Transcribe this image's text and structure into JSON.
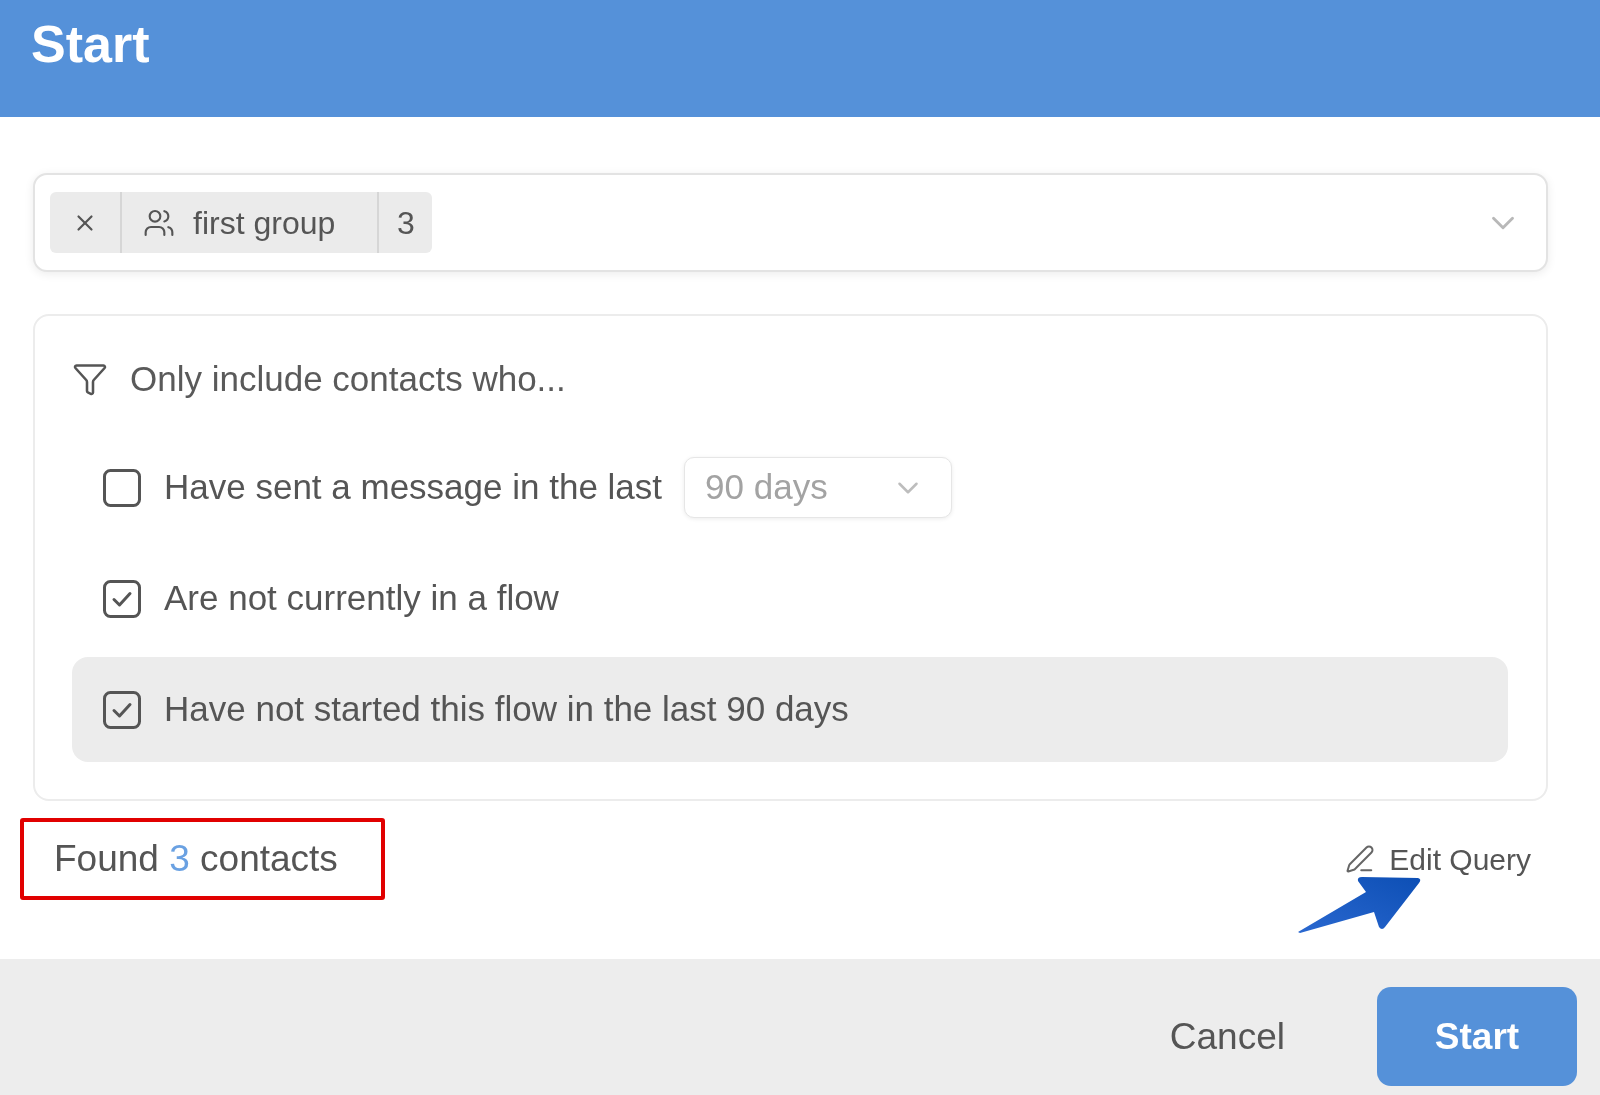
{
  "header": {
    "title": "Start"
  },
  "recipients": {
    "chips": [
      {
        "kind": "group",
        "name": "first group",
        "count": "3"
      }
    ]
  },
  "filters": {
    "title": "Only include contacts who...",
    "options": [
      {
        "kind": "select",
        "label": "Have sent a message in the last",
        "checked": false,
        "hovered": false,
        "select_value": "90 days"
      },
      {
        "kind": "plain",
        "label": "Are not currently in a flow",
        "checked": true,
        "hovered": false
      },
      {
        "kind": "plain",
        "label": "Have not started this flow in the last 90 days",
        "checked": true,
        "hovered": true
      }
    ]
  },
  "result": {
    "prefix": "Found",
    "count": "3",
    "suffix": "contacts",
    "highlighted": true
  },
  "edit_query": {
    "label": "Edit Query",
    "pointed_at": true
  },
  "footer": {
    "buttons": [
      {
        "kind": "secondary",
        "label": "Cancel"
      },
      {
        "kind": "primary",
        "label": "Start"
      }
    ]
  }
}
